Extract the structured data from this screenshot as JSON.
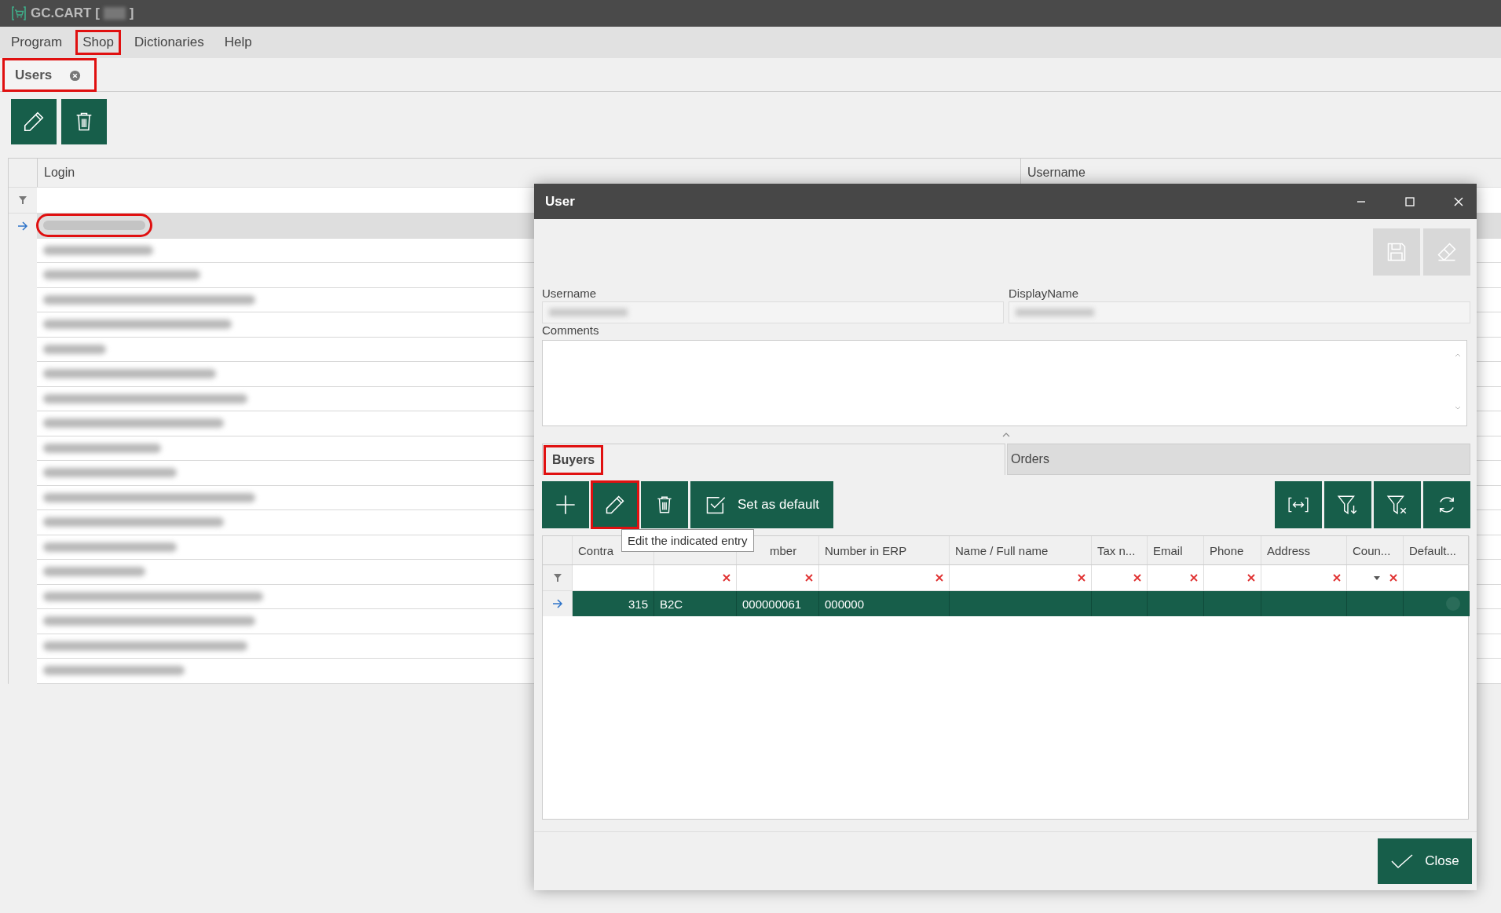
{
  "window": {
    "title": "GC.CART [",
    "title_end": "]"
  },
  "menu": [
    {
      "label": "Program",
      "highlighted": false
    },
    {
      "label": "Shop",
      "highlighted": true
    },
    {
      "label": "Dictionaries",
      "highlighted": false
    },
    {
      "label": "Help",
      "highlighted": false
    }
  ],
  "tabs": [
    {
      "label": "Users",
      "selected": true,
      "highlighted": true
    }
  ],
  "toolbar": [
    {
      "kind": "edit",
      "highlighted": false
    },
    {
      "kind": "delete",
      "highlighted": false
    }
  ],
  "users_table": {
    "columns": [
      "Login",
      "Username"
    ],
    "rows": [
      {
        "selected": true,
        "highlighted": true
      },
      {
        "selected": false,
        "highlighted": false
      },
      {
        "selected": false,
        "highlighted": false
      },
      {
        "selected": false,
        "highlighted": false
      },
      {
        "selected": false,
        "highlighted": false
      },
      {
        "selected": false,
        "highlighted": false
      },
      {
        "selected": false,
        "highlighted": false
      },
      {
        "selected": false,
        "highlighted": false
      },
      {
        "selected": false,
        "highlighted": false
      },
      {
        "selected": false,
        "highlighted": false
      },
      {
        "selected": false,
        "highlighted": false
      },
      {
        "selected": false,
        "highlighted": false
      },
      {
        "selected": false,
        "highlighted": false
      },
      {
        "selected": false,
        "highlighted": false
      },
      {
        "selected": false,
        "highlighted": false
      },
      {
        "selected": false,
        "highlighted": false
      },
      {
        "selected": false,
        "highlighted": false
      },
      {
        "selected": false,
        "highlighted": false
      },
      {
        "selected": false,
        "highlighted": false
      }
    ]
  },
  "dialog": {
    "title": "User",
    "actions": [
      {
        "kind": "save",
        "disabled": true
      },
      {
        "kind": "erase",
        "disabled": true
      }
    ],
    "fields": [
      {
        "label": "Username"
      },
      {
        "label": "DisplayName"
      }
    ],
    "comments": {
      "label": "Comments"
    },
    "tabs": [
      {
        "label": "Buyers",
        "selected": true,
        "highlighted": true
      },
      {
        "label": "Orders",
        "selected": false,
        "highlighted": false
      }
    ],
    "toolbar": [
      {
        "kind": "add",
        "highlighted": false
      },
      {
        "kind": "edit",
        "highlighted": true
      },
      {
        "kind": "delete",
        "highlighted": false
      },
      {
        "kind": "set_default",
        "label": "Set as default",
        "highlighted": false
      }
    ],
    "tools": [
      {
        "kind": "fit"
      },
      {
        "kind": "filter_apply"
      },
      {
        "kind": "filter_clear"
      },
      {
        "kind": "refresh"
      }
    ],
    "tooltip": "Edit the indicated entry",
    "grid": {
      "columns": [
        {
          "label": "Contra",
          "kind": "plain"
        },
        {
          "kind": "text"
        },
        {
          "label": "mber",
          "kind": "text"
        },
        {
          "label": "Number in ERP",
          "kind": "text"
        },
        {
          "label": "Name / Full name",
          "kind": "text"
        },
        {
          "label": "Tax n...",
          "kind": "text"
        },
        {
          "label": "Email",
          "kind": "text"
        },
        {
          "label": "Phone",
          "kind": "text"
        },
        {
          "label": "Address",
          "kind": "text"
        },
        {
          "label": "Coun...",
          "kind": "dropdown"
        },
        {
          "label": "Default...",
          "kind": "plain"
        }
      ],
      "rows": [
        {
          "selected": true,
          "cells": [
            "315",
            "B2C",
            "000000061",
            "000000"
          ],
          "default": false
        }
      ]
    },
    "close_button": "Close"
  }
}
